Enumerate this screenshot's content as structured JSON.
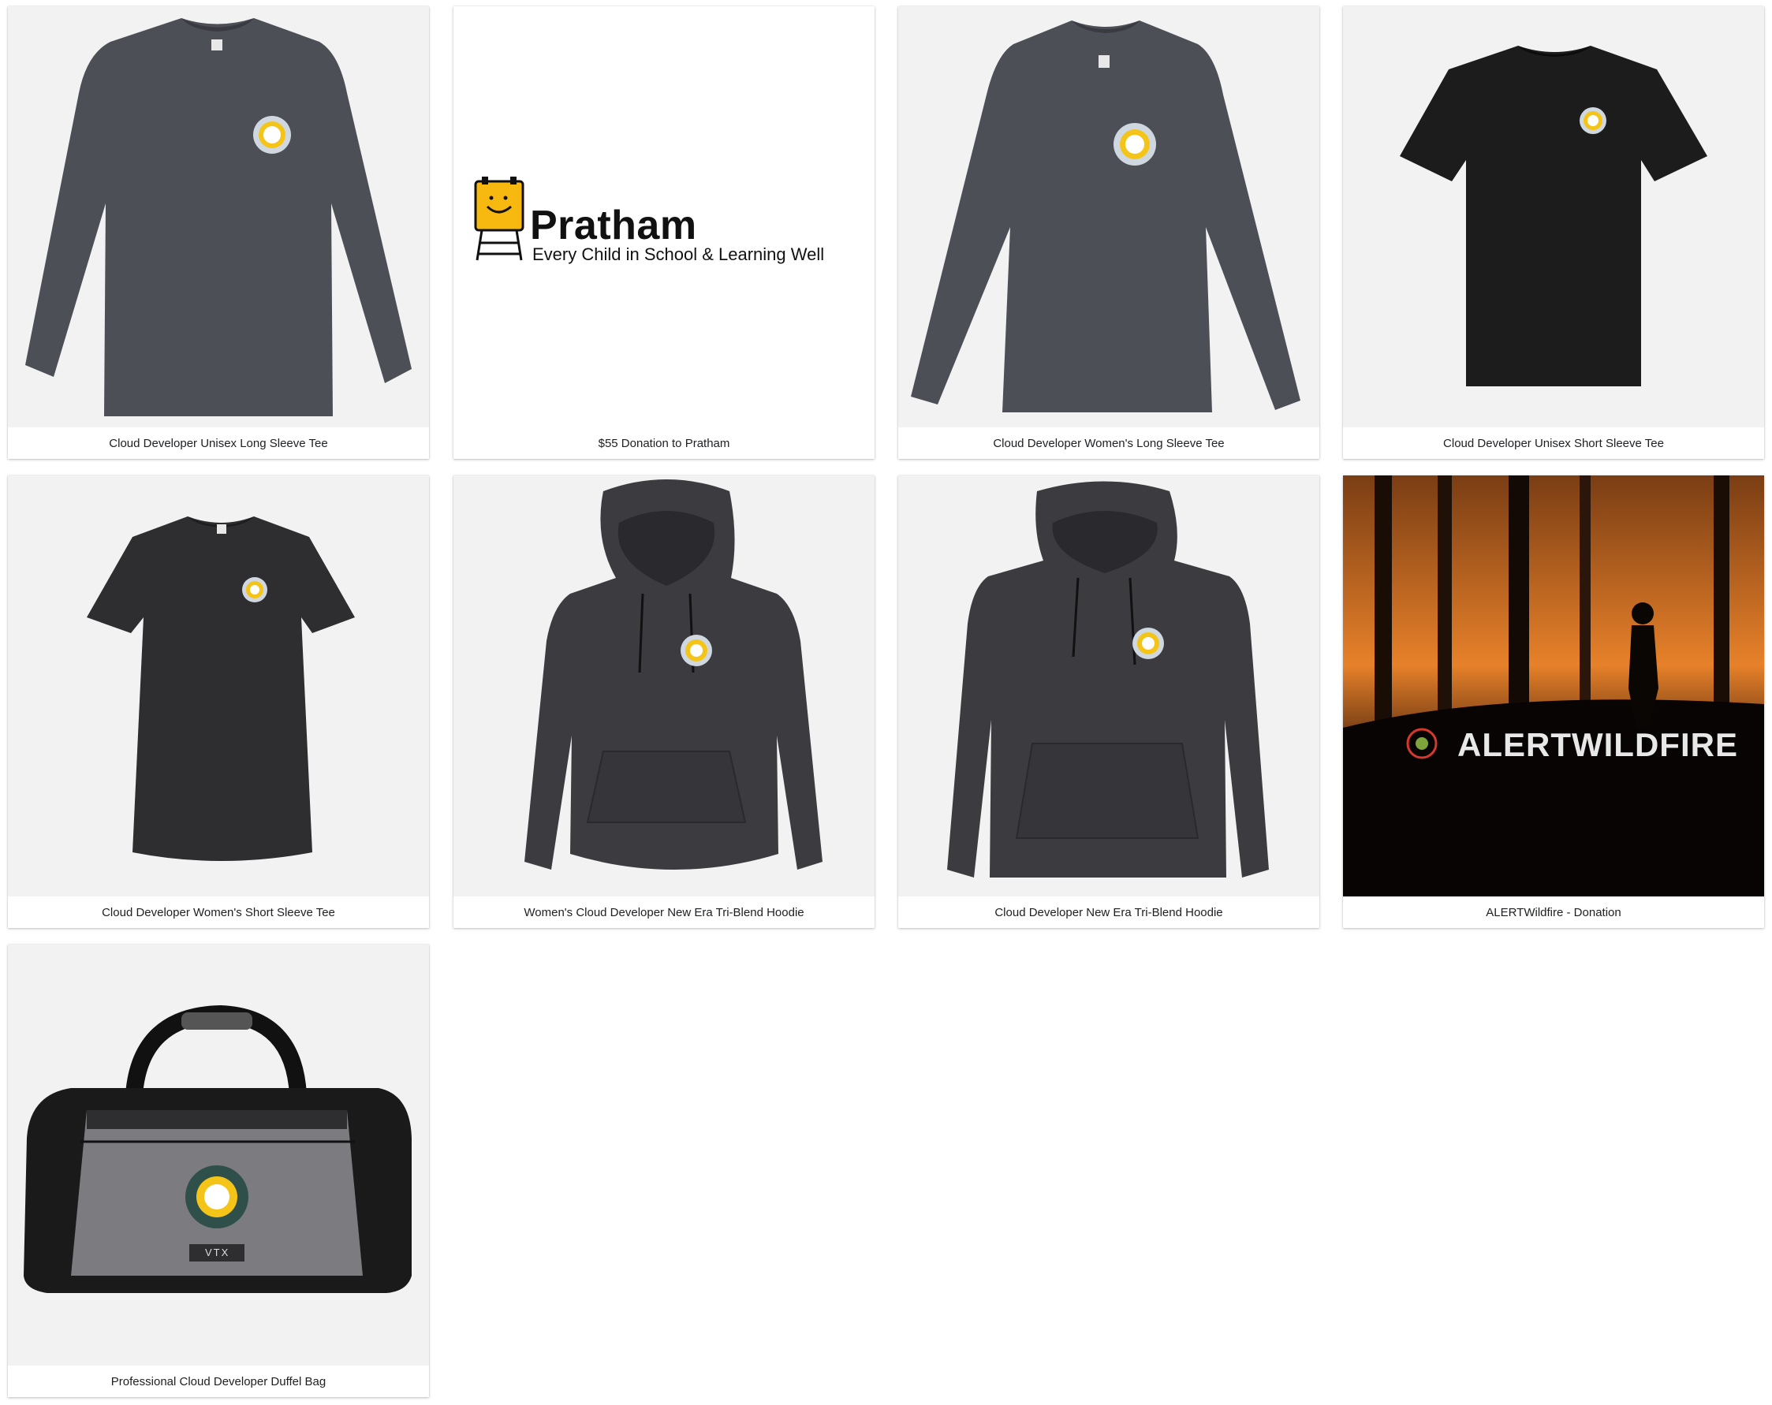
{
  "products": [
    {
      "name": "Cloud Developer Unisex Long Sleeve Tee"
    },
    {
      "name": "$55 Donation to Pratham"
    },
    {
      "name": "Cloud Developer Women's Long Sleeve Tee"
    },
    {
      "name": "Cloud Developer Unisex Short Sleeve Tee"
    },
    {
      "name": "Cloud Developer Women's Short Sleeve Tee"
    },
    {
      "name": "Women's Cloud Developer New Era Tri-Blend Hoodie"
    },
    {
      "name": "Cloud Developer New Era Tri-Blend Hoodie"
    },
    {
      "name": "ALERTWildfire - Donation"
    },
    {
      "name": "Professional Cloud Developer Duffel Bag"
    }
  ],
  "pratham": {
    "brand": "Pratham",
    "tagline": "Every Child in School & Learning Well"
  },
  "alertwildfire": {
    "brand": "ALERTWILDFIRE"
  },
  "duffel": {
    "tag": "VTX"
  },
  "colors": {
    "heather_gray": "#4d4f57",
    "black_tee": "#1c1c1c",
    "dark_heather": "#2e2e31",
    "pratham_yellow": "#f7b90f",
    "fire_orange": "#e7812a"
  }
}
